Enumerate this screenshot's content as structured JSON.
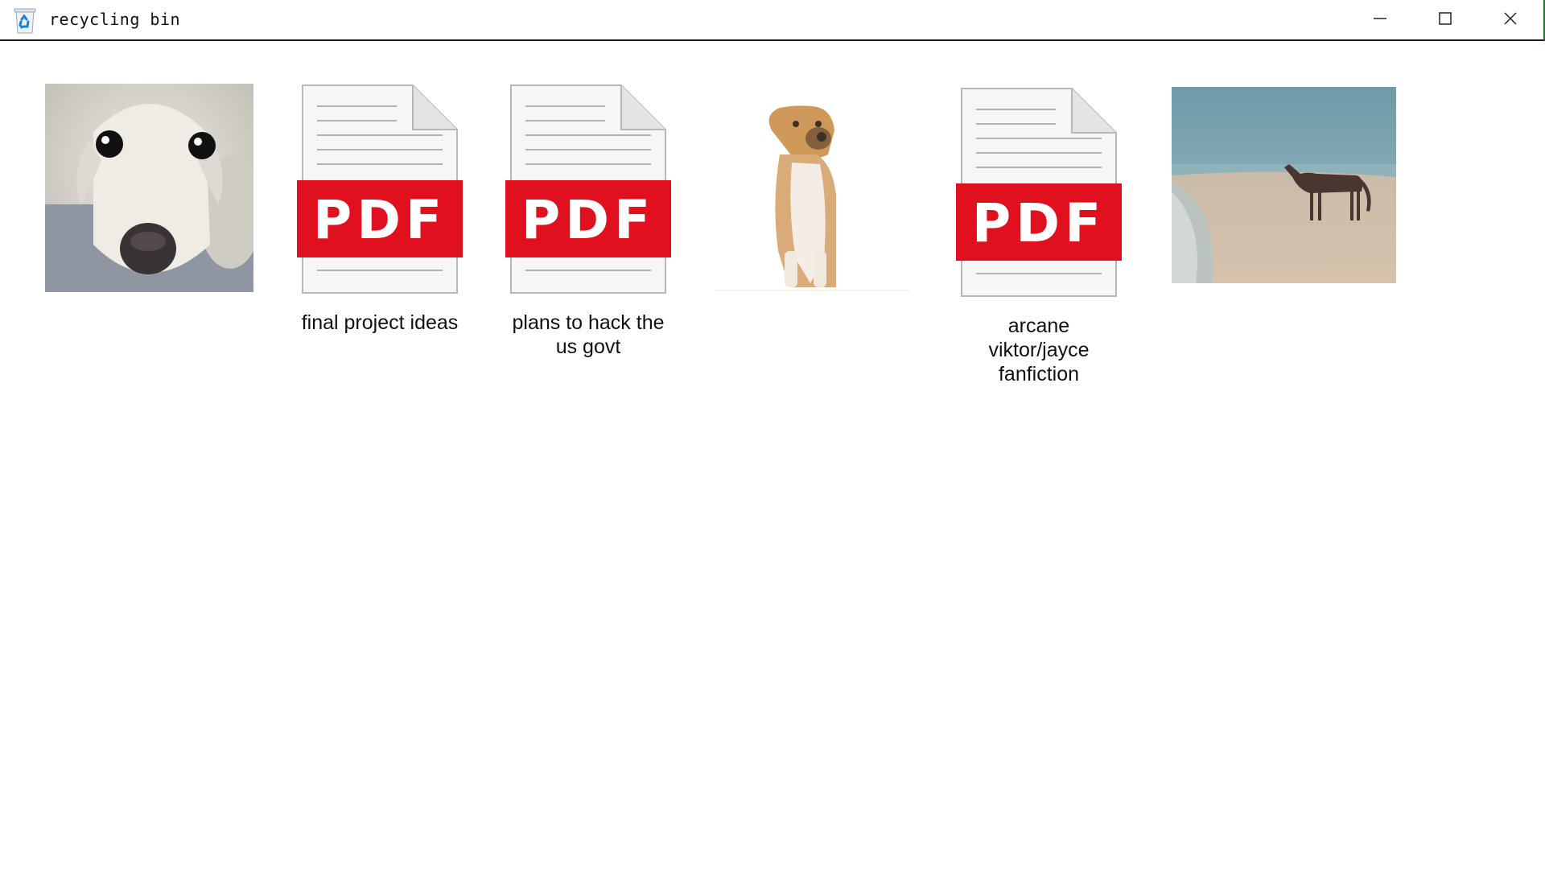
{
  "window": {
    "title": "recycling bin",
    "app_icon": "recycle-bin-icon",
    "controls": {
      "minimize_icon": "minimize-icon",
      "maximize_icon": "maximize-icon",
      "close_icon": "close-icon"
    }
  },
  "files": [
    {
      "kind": "image",
      "subject": "dog-face-photo",
      "label": ""
    },
    {
      "kind": "pdf",
      "badge": "PDF",
      "label": "final project ideas"
    },
    {
      "kind": "pdf",
      "badge": "PDF",
      "label": "plans to hack the\nus govt"
    },
    {
      "kind": "image",
      "subject": "sitting-dog-photo",
      "label": ""
    },
    {
      "kind": "pdf",
      "badge": "PDF",
      "label": "arcane viktor/jayce\nfanfiction"
    },
    {
      "kind": "image",
      "subject": "horse-on-beach-photo",
      "label": ""
    }
  ],
  "colors": {
    "pdf_red": "#e0101e",
    "titlebar_border": "#1c1c1c",
    "accent_edge": "#1a7a2a"
  }
}
